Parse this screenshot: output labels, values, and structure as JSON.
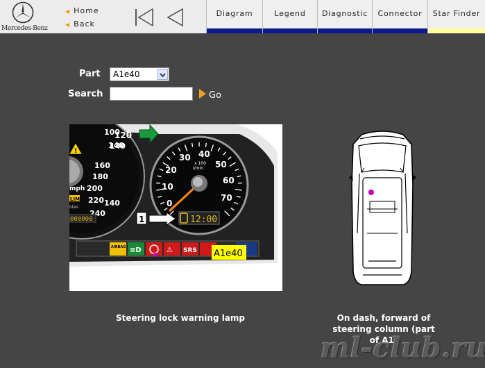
{
  "header": {
    "brand": "Mercedes-Benz",
    "home_label": "Home",
    "back_label": "Back",
    "tabs": [
      {
        "label": "Diagram"
      },
      {
        "label": "Legend"
      },
      {
        "label": "Diagnostic"
      },
      {
        "label": "Connector"
      },
      {
        "label": "Star Finder"
      }
    ]
  },
  "form": {
    "part_label": "Part",
    "part_value": "A1e40",
    "search_label": "Search",
    "search_value": "",
    "go_label": "Go"
  },
  "cluster_view": {
    "speedo_ticks": [
      "100",
      "120",
      "140",
      "160",
      "180",
      "200",
      "220",
      "240",
      "140"
    ],
    "speedo_labels": [
      "mph",
      "LIM",
      "ntes"
    ],
    "odometer": "000000",
    "tacho_ticks": [
      "0",
      "10",
      "20",
      "30",
      "40",
      "50",
      "60",
      "70"
    ],
    "tacho_unit_1": "x 100",
    "tacho_unit_2": "l/min",
    "clock": "12:00",
    "callout_number": "1",
    "warning_lights": [
      "AIRBAG OFF",
      "SRS"
    ],
    "part_tag": "A1e40",
    "caption": "Steering lock warning lamp"
  },
  "location_view": {
    "caption_lines": [
      "On dash, forward of",
      "steering column (part",
      "of A1)"
    ]
  },
  "watermark": "ml-club.ru",
  "colors": {
    "background": "#454545",
    "tab_bar": "#0b1a8a",
    "active_tab_bar": "#ffff9e",
    "go_arrow": "#f0a020",
    "part_tag": "#ffff00",
    "marker": "#c000c0"
  }
}
